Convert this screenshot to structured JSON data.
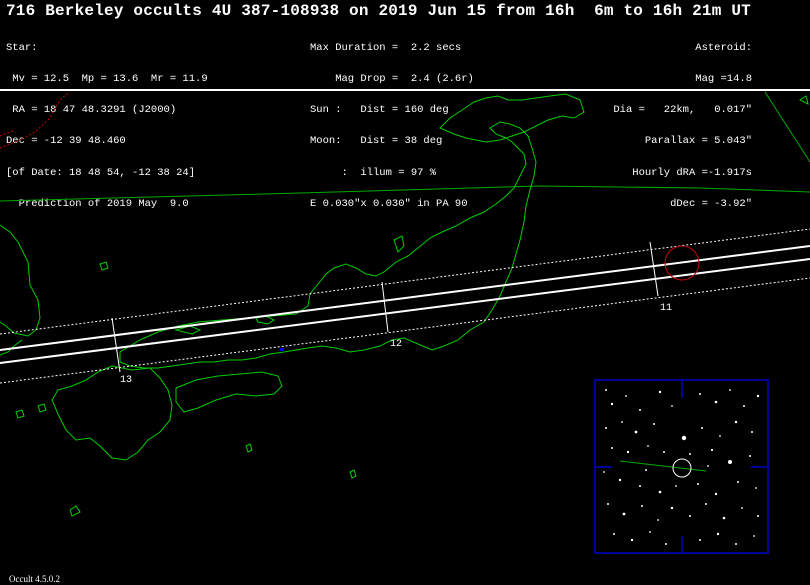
{
  "title": "716 Berkeley occults 4U 387-108938 on 2019 Jun 15 from 16h  6m to 16h 21m UT",
  "star_lines": [
    "Star:",
    " Mv = 12.5  Mp = 13.6  Mr = 11.9",
    " RA = 18 47 48.3291 (J2000)",
    "Dec = -12 39 48.460",
    "[of Date: 18 48 54, -12 38 24]",
    "  Prediction of 2019 May  9.0"
  ],
  "event_lines": [
    "Max Duration =  2.2 secs",
    "    Mag Drop =  2.4 (2.6r)",
    "Sun :   Dist = 160 deg",
    "Moon:   Dist = 38 deg",
    "     :  illum = 97 %",
    "E 0.030\"x 0.030\" in PA 90"
  ],
  "asteroid_lines": [
    "Asteroid:",
    "Mag =14.8",
    "Dia =   22km,   0.017\"",
    "Parallax = 5.043\"",
    "Hourly dRA =-1.917s",
    "dDec = -3.92\""
  ],
  "time_ticks": [
    "11",
    "12",
    "13"
  ],
  "footer": "Occult 4.5.0.2",
  "colors": {
    "background": "#000000",
    "coastline": "#00cc00",
    "path": "#ffffff",
    "border": "#cc0000",
    "starchart_frame": "#0000cc",
    "observer_circle": "#cc0000"
  }
}
